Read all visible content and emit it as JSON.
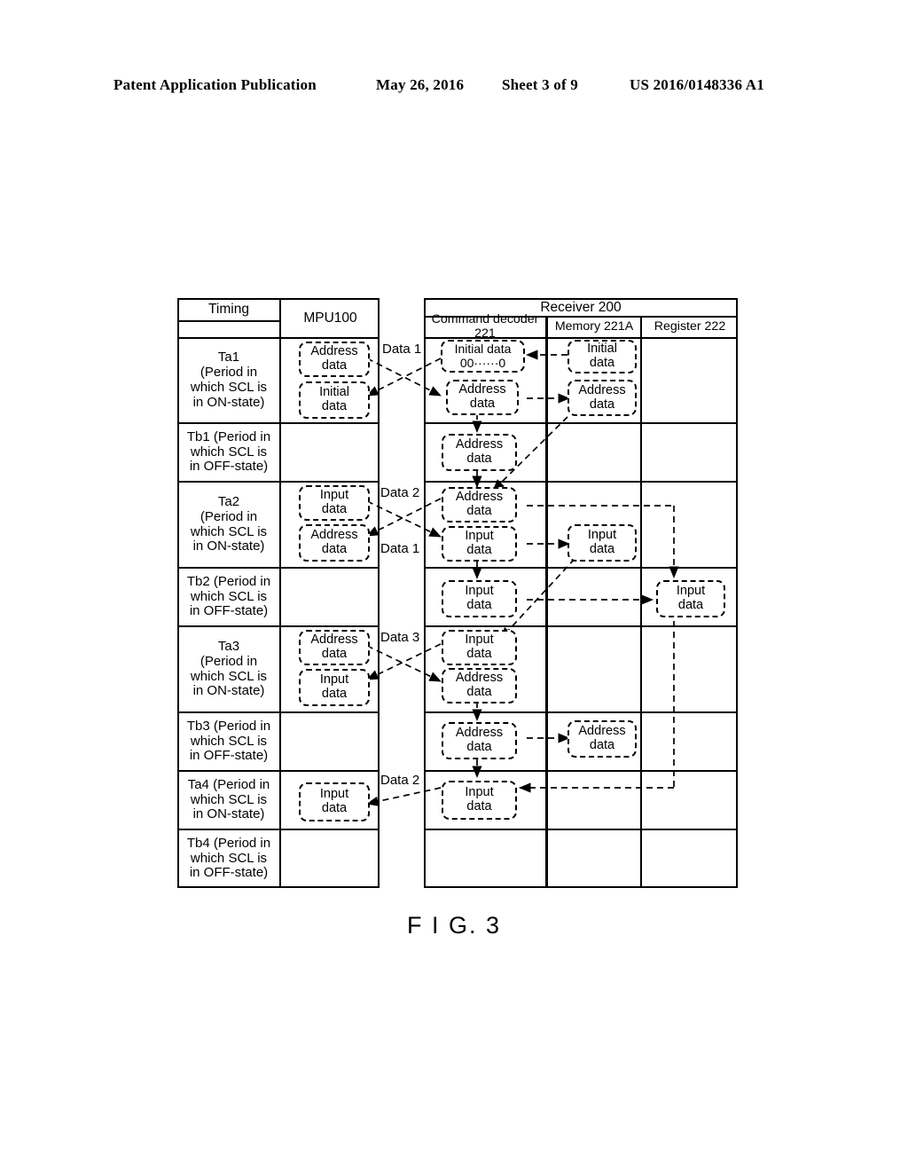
{
  "header": {
    "publication": "Patent Application Publication",
    "date": "May 26, 2016",
    "sheet": "Sheet 3 of 9",
    "patent_number": "US 2016/0148336 A1"
  },
  "figure": {
    "label": "F I G. 3",
    "left_table": {
      "columns": [
        {
          "id": "timing",
          "header": "Timing"
        },
        {
          "id": "mpu",
          "header": "MPU100"
        }
      ]
    },
    "right_table": {
      "group_header": "Receiver 200",
      "columns": [
        {
          "id": "command_decoder",
          "header": "Command decoder 221"
        },
        {
          "id": "memory",
          "header": "Memory 221A"
        },
        {
          "id": "register",
          "header": "Register 222"
        }
      ]
    },
    "rows": [
      {
        "id": "ta1",
        "timing": "Ta1\n(Period in\nwhich SCL is\nin ON-state)",
        "mpu": [
          "Address\ndata",
          "Initial\ndata"
        ],
        "command_decoder": [
          "Initial data\n00······0",
          "Address\ndata"
        ],
        "memory": [
          "Initial\ndata",
          "Address\ndata"
        ],
        "register": [],
        "bus_labels": [
          "Data 1"
        ]
      },
      {
        "id": "tb1",
        "timing": "Tb1 (Period in\nwhich SCL is\nin OFF-state)",
        "mpu": [],
        "command_decoder": [
          "Address\ndata"
        ],
        "memory": [],
        "register": [],
        "bus_labels": []
      },
      {
        "id": "ta2",
        "timing": "Ta2\n(Period in\nwhich SCL is\nin ON-state)",
        "mpu": [
          "Input\ndata",
          "Address\ndata"
        ],
        "command_decoder": [
          "Address\ndata",
          "Input\ndata"
        ],
        "memory": [
          "Input\ndata"
        ],
        "register": [],
        "bus_labels": [
          "Data 2",
          "Data 1"
        ]
      },
      {
        "id": "tb2",
        "timing": "Tb2 (Period in\nwhich SCL is\nin OFF-state)",
        "mpu": [],
        "command_decoder": [
          "Input\ndata"
        ],
        "memory": [],
        "register": [
          "Input\ndata"
        ],
        "bus_labels": []
      },
      {
        "id": "ta3",
        "timing": "Ta3\n(Period in\nwhich SCL is\nin ON-state)",
        "mpu": [
          "Address\ndata",
          "Input\ndata"
        ],
        "command_decoder": [
          "Input\ndata",
          "Address\ndata"
        ],
        "memory": [],
        "register": [],
        "bus_labels": [
          "Data 3"
        ]
      },
      {
        "id": "tb3",
        "timing": "Tb3 (Period in\nwhich SCL is\nin OFF-state)",
        "mpu": [],
        "command_decoder": [
          "Address\ndata"
        ],
        "memory": [
          "Address\ndata"
        ],
        "register": [],
        "bus_labels": []
      },
      {
        "id": "ta4",
        "timing": "Ta4 (Period in\nwhich SCL is\nin ON-state)",
        "mpu": [
          "Input\ndata"
        ],
        "command_decoder": [
          "Input\ndata"
        ],
        "memory": [],
        "register": [],
        "bus_labels": [
          "Data 2"
        ]
      },
      {
        "id": "tb4",
        "timing": "Tb4 (Period in\nwhich SCL is\nin OFF-state)",
        "mpu": [],
        "command_decoder": [],
        "memory": [],
        "register": [],
        "bus_labels": []
      }
    ]
  }
}
